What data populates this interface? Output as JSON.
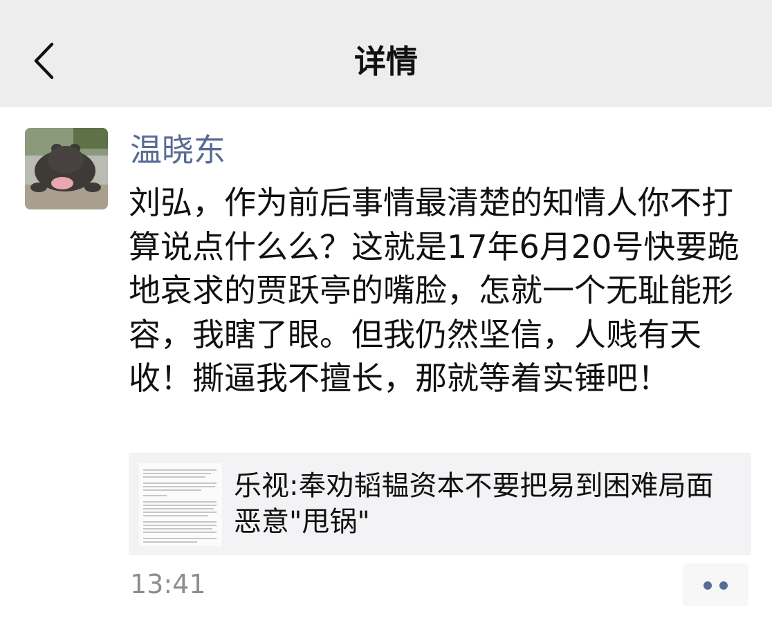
{
  "nav": {
    "back_icon": "chevron-left-icon",
    "title": "详情"
  },
  "post": {
    "author": "温晓东",
    "avatar_icon": "hippo-avatar",
    "text": "刘弘，作为前后事情最清楚的知情人你不打算说点什么么？这就是17年6月20号快要跪地哀求的贾跃亭的嘴脸，怎就一个无耻能形容，我瞎了眼。但我仍然坚信，人贱有天收！撕逼我不擅长，那就等着实锤吧！",
    "link": {
      "title": "乐视:奉劝韬韫资本不要把易到困难局面恶意\"甩锅\"",
      "thumbnail_icon": "document-thumbnail"
    },
    "time": "13:41",
    "more_icon": "more-dots-icon"
  },
  "colors": {
    "nav_bg": "#ededed",
    "author_link": "#576b95",
    "card_bg": "#f3f3f5",
    "time_gray": "#8d8d8d"
  }
}
